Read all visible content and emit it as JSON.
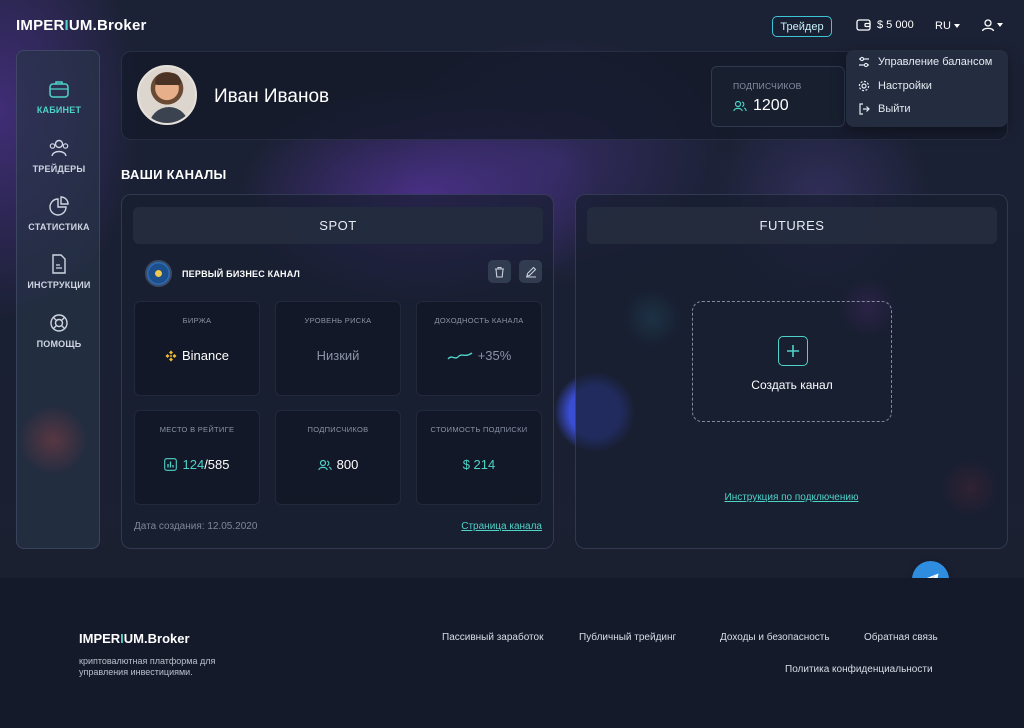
{
  "header": {
    "logo_main": "IMPER",
    "logo_accent": "I",
    "logo_rest": "UM",
    "logo_suffix": ".Broker",
    "trader_label": "Трейдер",
    "balance": "$ 5 000",
    "language": "RU"
  },
  "sidebar": {
    "items": [
      {
        "label": "КАБИНЕТ",
        "icon": "briefcase-icon",
        "active": true
      },
      {
        "label": "ТРЕЙДЕРЫ",
        "icon": "users-icon",
        "active": false
      },
      {
        "label": "СТАТИСТИКА",
        "icon": "pie-chart-icon",
        "active": false
      },
      {
        "label": "ИНСТРУКЦИИ",
        "icon": "document-icon",
        "active": false
      },
      {
        "label": "ПОМОЩЬ",
        "icon": "lifebuoy-icon",
        "active": false
      }
    ]
  },
  "profile": {
    "name": "Иван Иванов",
    "subscribers_title": "ПОДПИСЧИКОВ",
    "subscribers_value": "1200"
  },
  "dropdown": {
    "items": [
      {
        "label": "Управление балансом",
        "icon": "sliders-icon"
      },
      {
        "label": "Настройки",
        "icon": "gear-icon"
      },
      {
        "label": "Выйти",
        "icon": "logout-icon"
      }
    ]
  },
  "channels": {
    "section_title": "ВАШИ КАНАЛЫ",
    "spot": {
      "title": "SPOT",
      "channel_name": "ПЕРВЫЙ БИЗНЕС КАНАЛ",
      "stats": [
        {
          "title": "БИРЖА",
          "value": "Binance"
        },
        {
          "title": "УРОВЕНЬ РИСКА",
          "value": "Низкий"
        },
        {
          "title": "ДОХОДНОСТЬ КАНАЛА",
          "value": "+35%"
        },
        {
          "title": "МЕСТО В РЕЙТИГЕ",
          "value_main": "124",
          "value_rest": "/585"
        },
        {
          "title": "ПОДПИСЧИКОВ",
          "value": "800"
        },
        {
          "title": "СТОИМОСТЬ ПОДПИСКИ",
          "value": "$ 214"
        }
      ],
      "created": "Дата создания: 12.05.2020",
      "channel_link": "Страница канала"
    },
    "futures": {
      "title": "FUTURES",
      "create_label": "Создать канал",
      "instruction_link": "Инструкция по подключению"
    }
  },
  "footer": {
    "logo_main": "IMPER",
    "logo_accent": "I",
    "logo_rest": "UM",
    "logo_suffix": ".Broker",
    "description": "криптовалютная платформа для управления инвестициями.",
    "links": [
      "Пассивный заработок",
      "Публичный трейдинг",
      "Доходы и безопасность",
      "Обратная связь",
      "Политика конфиденциальности"
    ]
  },
  "colors": {
    "accent": "#4fd2c8",
    "telegram": "#2f8de0",
    "binance": "#f3ba2f"
  }
}
